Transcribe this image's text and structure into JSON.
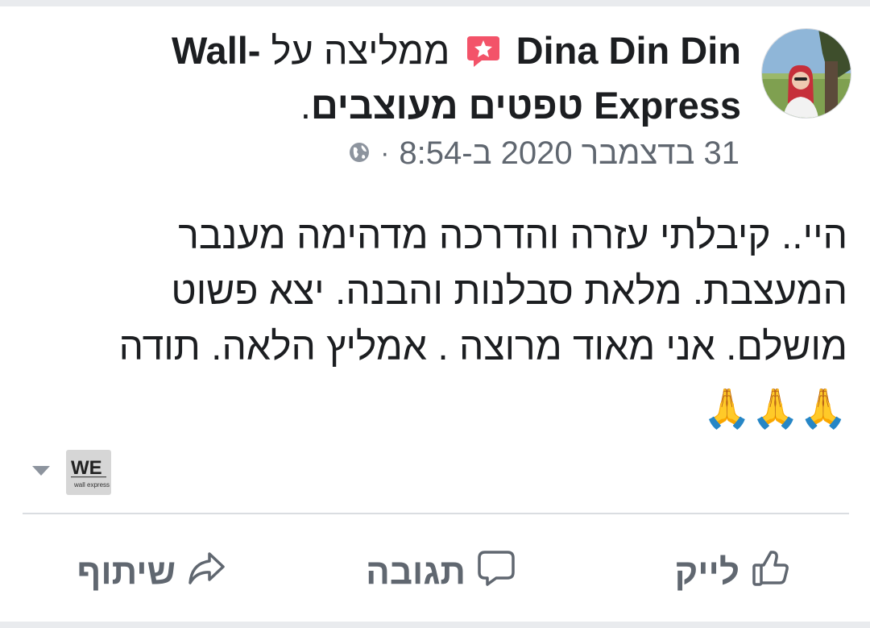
{
  "post": {
    "author": "Dina Din Din",
    "recommendation_text": "ממליצה על",
    "page_name": "Wall- Express טפטים מעוצבים",
    "period": ".",
    "date_time": "31 בדצמבר 2020 ב-8:54",
    "meta_dot": "·",
    "body_lines": [
      "היי.. קיבלתי עזרה והדרכה מדהימה מענבר",
      "המעצבת. מלאת סבלנות והבנה. יצא פשוט",
      "מושלם. אני מאוד מרוצה . אמליץ הלאה. תודה"
    ],
    "emoji": "🙏🙏🙏"
  },
  "page_logo": {
    "letters": "WE",
    "subtext": "wall express"
  },
  "actions": {
    "like_label": "לייק",
    "comment_label": "תגובה",
    "share_label": "שיתוף"
  },
  "icons": {
    "recommend": "recommend-star-icon",
    "privacy": "globe-icon",
    "like": "thumbs-up-icon",
    "comment": "comment-bubble-icon",
    "share": "share-arrow-icon",
    "dropdown": "chevron-down-icon"
  },
  "colors": {
    "recommend_badge": "#f35369",
    "text_primary": "#1c1e21",
    "text_secondary": "#606770",
    "background": "#e9ebee"
  }
}
